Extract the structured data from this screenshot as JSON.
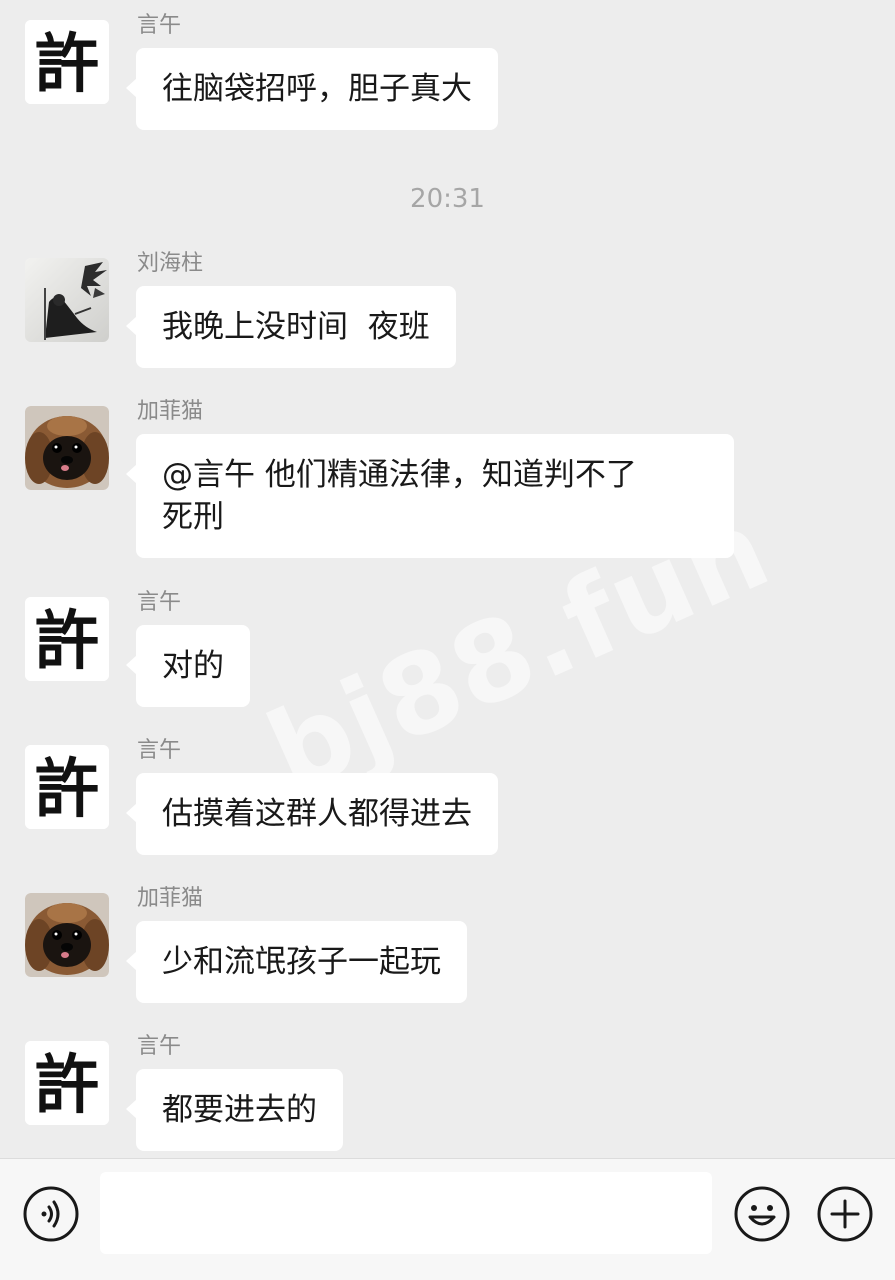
{
  "messages": [
    {
      "sender": "言午",
      "text": "往脑袋招呼，胆子真大",
      "avatar": "xu-calligraphy"
    },
    {
      "sender": "刘海柱",
      "text": "我晚上没时间  夜班",
      "avatar": "ink-painting"
    },
    {
      "sender": "加菲猫",
      "text": "@言午 他们精通法律，知道判不了\n死刑",
      "avatar": "pekingese-dog"
    },
    {
      "sender": "言午",
      "text": "对的",
      "avatar": "xu-calligraphy"
    },
    {
      "sender": "言午",
      "text": "估摸着这群人都得进去",
      "avatar": "xu-calligraphy"
    },
    {
      "sender": "加菲猫",
      "text": "少和流氓孩子一起玩",
      "avatar": "pekingese-dog"
    },
    {
      "sender": "言午",
      "text": "都要进去的",
      "avatar": "xu-calligraphy"
    }
  ],
  "timestamp": "20:31",
  "watermark": "bj88.fun",
  "avatar_glyph": "許",
  "input": {
    "value": "",
    "voice_icon": "voice-icon",
    "emoji_icon": "emoji-icon",
    "plus_icon": "plus-icon"
  },
  "colors": {
    "background": "#ededed",
    "bubble": "#ffffff",
    "sender": "#8a8a8a",
    "timestamp": "#a6a6a6"
  }
}
